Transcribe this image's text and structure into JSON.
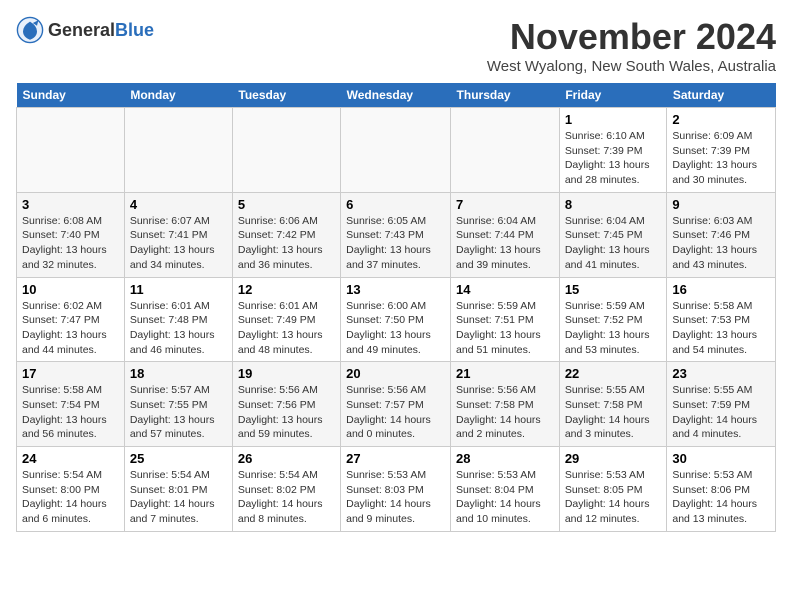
{
  "header": {
    "logo_general": "General",
    "logo_blue": "Blue",
    "title": "November 2024",
    "subtitle": "West Wyalong, New South Wales, Australia"
  },
  "days_of_week": [
    "Sunday",
    "Monday",
    "Tuesday",
    "Wednesday",
    "Thursday",
    "Friday",
    "Saturday"
  ],
  "weeks": [
    [
      {
        "day": "",
        "info": ""
      },
      {
        "day": "",
        "info": ""
      },
      {
        "day": "",
        "info": ""
      },
      {
        "day": "",
        "info": ""
      },
      {
        "day": "",
        "info": ""
      },
      {
        "day": "1",
        "info": "Sunrise: 6:10 AM\nSunset: 7:39 PM\nDaylight: 13 hours\nand 28 minutes."
      },
      {
        "day": "2",
        "info": "Sunrise: 6:09 AM\nSunset: 7:39 PM\nDaylight: 13 hours\nand 30 minutes."
      }
    ],
    [
      {
        "day": "3",
        "info": "Sunrise: 6:08 AM\nSunset: 7:40 PM\nDaylight: 13 hours\nand 32 minutes."
      },
      {
        "day": "4",
        "info": "Sunrise: 6:07 AM\nSunset: 7:41 PM\nDaylight: 13 hours\nand 34 minutes."
      },
      {
        "day": "5",
        "info": "Sunrise: 6:06 AM\nSunset: 7:42 PM\nDaylight: 13 hours\nand 36 minutes."
      },
      {
        "day": "6",
        "info": "Sunrise: 6:05 AM\nSunset: 7:43 PM\nDaylight: 13 hours\nand 37 minutes."
      },
      {
        "day": "7",
        "info": "Sunrise: 6:04 AM\nSunset: 7:44 PM\nDaylight: 13 hours\nand 39 minutes."
      },
      {
        "day": "8",
        "info": "Sunrise: 6:04 AM\nSunset: 7:45 PM\nDaylight: 13 hours\nand 41 minutes."
      },
      {
        "day": "9",
        "info": "Sunrise: 6:03 AM\nSunset: 7:46 PM\nDaylight: 13 hours\nand 43 minutes."
      }
    ],
    [
      {
        "day": "10",
        "info": "Sunrise: 6:02 AM\nSunset: 7:47 PM\nDaylight: 13 hours\nand 44 minutes."
      },
      {
        "day": "11",
        "info": "Sunrise: 6:01 AM\nSunset: 7:48 PM\nDaylight: 13 hours\nand 46 minutes."
      },
      {
        "day": "12",
        "info": "Sunrise: 6:01 AM\nSunset: 7:49 PM\nDaylight: 13 hours\nand 48 minutes."
      },
      {
        "day": "13",
        "info": "Sunrise: 6:00 AM\nSunset: 7:50 PM\nDaylight: 13 hours\nand 49 minutes."
      },
      {
        "day": "14",
        "info": "Sunrise: 5:59 AM\nSunset: 7:51 PM\nDaylight: 13 hours\nand 51 minutes."
      },
      {
        "day": "15",
        "info": "Sunrise: 5:59 AM\nSunset: 7:52 PM\nDaylight: 13 hours\nand 53 minutes."
      },
      {
        "day": "16",
        "info": "Sunrise: 5:58 AM\nSunset: 7:53 PM\nDaylight: 13 hours\nand 54 minutes."
      }
    ],
    [
      {
        "day": "17",
        "info": "Sunrise: 5:58 AM\nSunset: 7:54 PM\nDaylight: 13 hours\nand 56 minutes."
      },
      {
        "day": "18",
        "info": "Sunrise: 5:57 AM\nSunset: 7:55 PM\nDaylight: 13 hours\nand 57 minutes."
      },
      {
        "day": "19",
        "info": "Sunrise: 5:56 AM\nSunset: 7:56 PM\nDaylight: 13 hours\nand 59 minutes."
      },
      {
        "day": "20",
        "info": "Sunrise: 5:56 AM\nSunset: 7:57 PM\nDaylight: 14 hours\nand 0 minutes."
      },
      {
        "day": "21",
        "info": "Sunrise: 5:56 AM\nSunset: 7:58 PM\nDaylight: 14 hours\nand 2 minutes."
      },
      {
        "day": "22",
        "info": "Sunrise: 5:55 AM\nSunset: 7:58 PM\nDaylight: 14 hours\nand 3 minutes."
      },
      {
        "day": "23",
        "info": "Sunrise: 5:55 AM\nSunset: 7:59 PM\nDaylight: 14 hours\nand 4 minutes."
      }
    ],
    [
      {
        "day": "24",
        "info": "Sunrise: 5:54 AM\nSunset: 8:00 PM\nDaylight: 14 hours\nand 6 minutes."
      },
      {
        "day": "25",
        "info": "Sunrise: 5:54 AM\nSunset: 8:01 PM\nDaylight: 14 hours\nand 7 minutes."
      },
      {
        "day": "26",
        "info": "Sunrise: 5:54 AM\nSunset: 8:02 PM\nDaylight: 14 hours\nand 8 minutes."
      },
      {
        "day": "27",
        "info": "Sunrise: 5:53 AM\nSunset: 8:03 PM\nDaylight: 14 hours\nand 9 minutes."
      },
      {
        "day": "28",
        "info": "Sunrise: 5:53 AM\nSunset: 8:04 PM\nDaylight: 14 hours\nand 10 minutes."
      },
      {
        "day": "29",
        "info": "Sunrise: 5:53 AM\nSunset: 8:05 PM\nDaylight: 14 hours\nand 12 minutes."
      },
      {
        "day": "30",
        "info": "Sunrise: 5:53 AM\nSunset: 8:06 PM\nDaylight: 14 hours\nand 13 minutes."
      }
    ]
  ]
}
